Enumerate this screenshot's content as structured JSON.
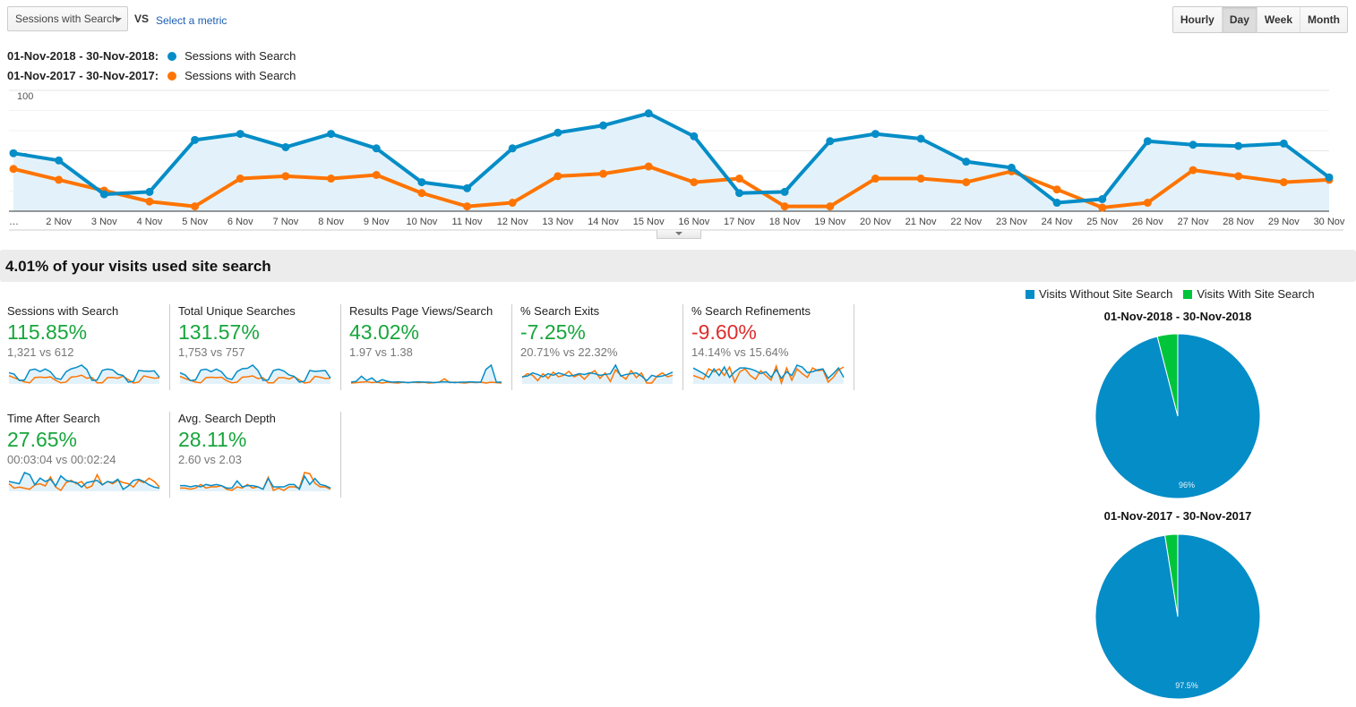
{
  "toolbar": {
    "metric_select": "Sessions with Search",
    "vs_label": "VS",
    "select_metric_link": "Select a metric",
    "granularity": [
      "Hourly",
      "Day",
      "Week",
      "Month"
    ],
    "granularity_active": "Day"
  },
  "legend": [
    {
      "range": "01-Nov-2018 - 30-Nov-2018:",
      "label": "Sessions with Search",
      "color": "#058dc7"
    },
    {
      "range": "01-Nov-2017 - 30-Nov-2017:",
      "label": "Sessions with Search",
      "color": "#ff7400"
    }
  ],
  "chart_data": [
    {
      "type": "line",
      "title": "",
      "xlabel": "",
      "ylabel": "",
      "ylim": [
        0,
        100
      ],
      "y_ticks": [
        "100",
        "50"
      ],
      "grid": true,
      "x": [
        "…",
        "2 Nov",
        "3 Nov",
        "4 Nov",
        "5 Nov",
        "6 Nov",
        "7 Nov",
        "8 Nov",
        "9 Nov",
        "10 Nov",
        "11 Nov",
        "12 Nov",
        "13 Nov",
        "14 Nov",
        "15 Nov",
        "16 Nov",
        "17 Nov",
        "18 Nov",
        "19 Nov",
        "20 Nov",
        "21 Nov",
        "22 Nov",
        "23 Nov",
        "24 Nov",
        "25 Nov",
        "26 Nov",
        "27 Nov",
        "28 Nov",
        "29 Nov",
        "30 Nov"
      ],
      "series": [
        {
          "name": "01-Nov-2018 - 30-Nov-2018: Sessions with Search",
          "color": "#058dc7",
          "area": true,
          "values": [
            48,
            42,
            14,
            16,
            59,
            64,
            53,
            64,
            52,
            24,
            19,
            52,
            65,
            71,
            81,
            62,
            15,
            16,
            58,
            64,
            60,
            41,
            36,
            7,
            10,
            58,
            55,
            54,
            56,
            28
          ]
        },
        {
          "name": "01-Nov-2017 - 30-Nov-2017: Sessions with Search",
          "color": "#ff7400",
          "area": false,
          "values": [
            35,
            26,
            17,
            8,
            4,
            27,
            29,
            27,
            30,
            15,
            4,
            7,
            29,
            31,
            37,
            24,
            27,
            4,
            4,
            27,
            27,
            24,
            33,
            18,
            3,
            7,
            34,
            29,
            24,
            26
          ]
        }
      ]
    },
    {
      "type": "pie",
      "title": "01-Nov-2018 - 30-Nov-2018",
      "categories": [
        "Visits Without Site Search",
        "Visits With Site Search"
      ],
      "values": [
        96,
        4
      ],
      "data_labels": [
        "96%",
        ""
      ],
      "colors": [
        "#058dc7",
        "#00c43a"
      ],
      "legend": "top"
    },
    {
      "type": "pie",
      "title": "01-Nov-2017 - 30-Nov-2017",
      "categories": [
        "Visits Without Site Search",
        "Visits With Site Search"
      ],
      "values": [
        97.5,
        2.5
      ],
      "data_labels": [
        "97.5%",
        ""
      ],
      "colors": [
        "#058dc7",
        "#00c43a"
      ],
      "legend": "top"
    }
  ],
  "summary": {
    "headline": "4.01% of your visits used site search"
  },
  "pie_legend": [
    {
      "label": "Visits Without Site Search",
      "color": "#058dc7"
    },
    {
      "label": "Visits With Site Search",
      "color": "#00c43a"
    }
  ],
  "metrics": [
    {
      "title": "Sessions with Search",
      "change": "115.85%",
      "direction": "positive",
      "comparison": "1,321 vs 612",
      "spark_a": [
        48,
        42,
        14,
        16,
        59,
        64,
        53,
        64,
        52,
        24,
        19,
        52,
        65,
        71,
        81,
        62,
        15,
        16,
        58,
        64,
        60,
        41,
        36,
        7,
        10,
        58,
        55,
        54,
        56,
        28
      ],
      "spark_b": [
        35,
        26,
        17,
        8,
        4,
        27,
        29,
        27,
        30,
        15,
        4,
        7,
        29,
        31,
        37,
        24,
        27,
        4,
        4,
        27,
        27,
        24,
        33,
        18,
        3,
        7,
        34,
        29,
        24,
        26
      ]
    },
    {
      "title": "Total Unique Searches",
      "change": "131.57%",
      "direction": "positive",
      "comparison": "1,753 vs 757",
      "spark_a": [
        50,
        40,
        15,
        18,
        62,
        66,
        55,
        66,
        54,
        26,
        20,
        55,
        68,
        70,
        84,
        60,
        16,
        18,
        60,
        66,
        58,
        40,
        34,
        8,
        12,
        60,
        56,
        58,
        60,
        26
      ],
      "spark_b": [
        34,
        24,
        16,
        8,
        5,
        28,
        30,
        28,
        30,
        14,
        5,
        8,
        30,
        32,
        36,
        24,
        28,
        5,
        5,
        28,
        28,
        22,
        32,
        18,
        4,
        8,
        34,
        30,
        24,
        26
      ]
    },
    {
      "title": "Results Page Views/Search",
      "change": "43.02%",
      "direction": "positive",
      "comparison": "1.97 vs 1.38",
      "spark_a": [
        30,
        32,
        44,
        34,
        40,
        30,
        36,
        32,
        30,
        31,
        30,
        29,
        30,
        31,
        30,
        30,
        29,
        30,
        31,
        30,
        29,
        30,
        30,
        31,
        30,
        30,
        60,
        70,
        30,
        30
      ],
      "spark_b": [
        28,
        29,
        30,
        31,
        29,
        30,
        28,
        30,
        29,
        28,
        30,
        29,
        30,
        29,
        30,
        28,
        29,
        30,
        38,
        29,
        30,
        29,
        28,
        30,
        29,
        30,
        28,
        30,
        29,
        28
      ]
    },
    {
      "title": "% Search Exits",
      "change": "-7.25%",
      "direction": "positive",
      "comparison": "20.71% vs 22.32%",
      "spark_a": [
        40,
        42,
        50,
        46,
        40,
        48,
        44,
        50,
        46,
        42,
        44,
        48,
        46,
        50,
        48,
        44,
        46,
        48,
        70,
        42,
        46,
        48,
        50,
        42,
        30,
        44,
        40,
        42,
        46,
        52
      ],
      "spark_b": [
        38,
        48,
        44,
        30,
        48,
        36,
        52,
        40,
        44,
        54,
        40,
        46,
        34,
        48,
        56,
        36,
        50,
        28,
        58,
        44,
        34,
        56,
        38,
        50,
        24,
        24,
        42,
        50,
        40,
        44
      ]
    },
    {
      "title": "% Search Refinements",
      "change": "-9.60%",
      "direction": "negative",
      "comparison": "14.14% vs 15.64%",
      "spark_a": [
        60,
        54,
        48,
        40,
        58,
        44,
        62,
        40,
        52,
        60,
        60,
        58,
        54,
        48,
        52,
        40,
        56,
        38,
        52,
        44,
        66,
        62,
        50,
        52,
        56,
        58,
        38,
        48,
        60,
        40
      ],
      "spark_b": [
        44,
        40,
        36,
        58,
        52,
        58,
        44,
        62,
        30,
        52,
        58,
        44,
        36,
        54,
        44,
        34,
        64,
        28,
        60,
        34,
        58,
        48,
        40,
        60,
        54,
        56,
        30,
        40,
        56,
        62
      ]
    },
    {
      "title": "Time After Search",
      "change": "27.65%",
      "direction": "positive",
      "comparison": "00:03:04 vs 00:02:24",
      "spark_a": [
        50,
        48,
        46,
        66,
        62,
        44,
        56,
        50,
        54,
        42,
        60,
        52,
        50,
        48,
        40,
        48,
        50,
        52,
        44,
        50,
        48,
        54,
        36,
        42,
        52,
        54,
        50,
        44,
        40,
        38
      ],
      "spark_b": [
        46,
        38,
        40,
        38,
        36,
        44,
        46,
        42,
        58,
        40,
        34,
        48,
        52,
        46,
        50,
        38,
        42,
        62,
        44,
        50,
        46,
        52,
        48,
        46,
        40,
        52,
        48,
        56,
        50,
        40
      ]
    },
    {
      "title": "Avg. Search Depth",
      "change": "28.11%",
      "direction": "positive",
      "comparison": "2.60 vs 2.03",
      "spark_a": [
        44,
        44,
        42,
        44,
        42,
        46,
        44,
        46,
        44,
        40,
        40,
        52,
        42,
        44,
        44,
        42,
        38,
        56,
        42,
        42,
        42,
        46,
        46,
        38,
        60,
        46,
        56,
        46,
        44,
        40
      ],
      "spark_b": [
        40,
        40,
        38,
        40,
        46,
        40,
        42,
        42,
        44,
        38,
        36,
        42,
        40,
        46,
        40,
        42,
        38,
        58,
        36,
        40,
        36,
        42,
        42,
        40,
        66,
        64,
        48,
        42,
        42,
        38
      ]
    }
  ]
}
